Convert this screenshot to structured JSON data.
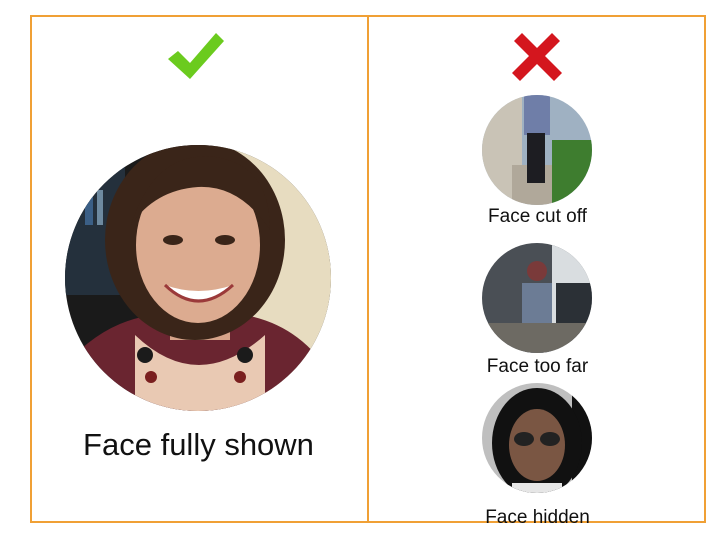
{
  "good": {
    "icon": "check-icon",
    "icon_color": "#6bcb1e",
    "caption": "Face fully shown"
  },
  "bad": {
    "icon": "cross-icon",
    "icon_color": "#d4161e",
    "examples": [
      {
        "caption": "Face cut off",
        "photo": "person-standing-outdoors-photo"
      },
      {
        "caption": "Face too far",
        "photo": "person-distant-porch-photo"
      },
      {
        "caption": "Face hidden",
        "photo": "person-sunglasses-photo"
      }
    ]
  },
  "colors": {
    "border": "#f0a035",
    "text": "#111111"
  }
}
